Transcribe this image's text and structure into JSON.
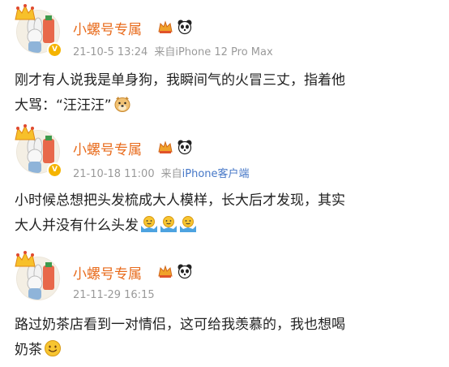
{
  "posts": [
    {
      "username": "小螺号专属",
      "time": "21-10-5 13:24",
      "source_prefix": "来自",
      "source": "iPhone 12 Pro Max",
      "text_line1": "刚才有人说我是单身狗，我瞬间气的火冒三丈，指着他",
      "text_line2": "大骂：“汪汪汪”",
      "emojis": [
        "doge-emoji"
      ]
    },
    {
      "username": "小螺号专属",
      "time": "21-10-18 11:00",
      "source_prefix": "来自",
      "source": "iPhone客户端",
      "text_line1": "小时候总想把头发梳成大人模样，长大后才发现，其实",
      "text_line2": "大人并没有什么头发",
      "emojis": [
        "shrug-emoji",
        "shrug-emoji",
        "shrug-emoji"
      ]
    },
    {
      "username": "小螺号专属",
      "time": "21-11-29 16:15",
      "source_prefix": "",
      "source": "",
      "text_line1": "路过奶茶店看到一对情侣，这可给我羡慕的，我也想喝",
      "text_line2": "奶茶",
      "emojis": [
        "smile-emoji"
      ]
    }
  ],
  "colors": {
    "username": "#e86b1c",
    "meta": "#9a9a9a",
    "link": "#4577c7",
    "verified": "#f5b400"
  },
  "icons": [
    "crown-decoration-icon",
    "vip-crown-icon",
    "panda-icon",
    "verified-badge-icon"
  ]
}
